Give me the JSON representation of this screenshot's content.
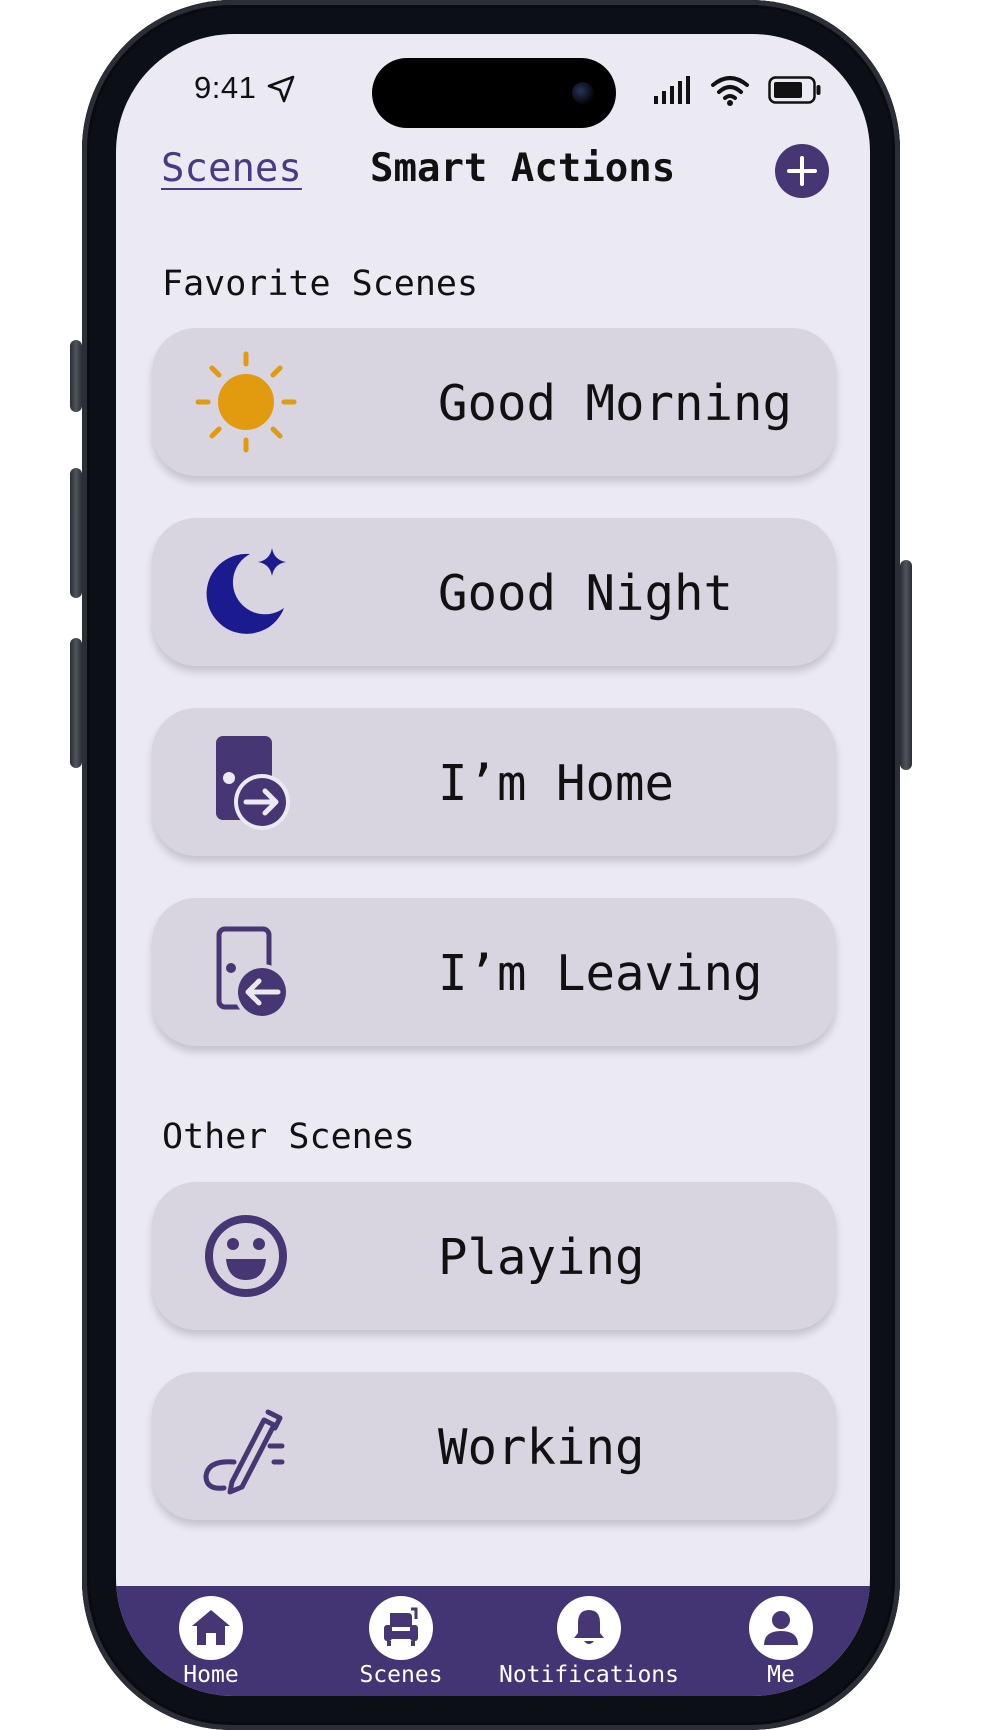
{
  "status_bar": {
    "time": "9:41"
  },
  "header": {
    "tab_scenes": "Scenes",
    "tab_smart_actions": "Smart Actions"
  },
  "favorites": {
    "title": "Favorite Scenes",
    "items": [
      {
        "label": "Good Morning",
        "icon": "sun-icon"
      },
      {
        "label": "Good Night",
        "icon": "moon-star-icon"
      },
      {
        "label": "I’m Home",
        "icon": "door-enter-icon"
      },
      {
        "label": "I’m Leaving",
        "icon": "door-leave-icon"
      }
    ]
  },
  "others": {
    "title": "Other Scenes",
    "items": [
      {
        "label": "Playing",
        "icon": "smiley-face-icon"
      },
      {
        "label": "Working",
        "icon": "pen-signature-icon"
      }
    ]
  },
  "bottom_nav": {
    "items": [
      {
        "label": "Home",
        "icon": "house-icon"
      },
      {
        "label": "Scenes",
        "icon": "armchair-icon"
      },
      {
        "label": "Notifications",
        "icon": "bell-icon"
      },
      {
        "label": "Me",
        "icon": "person-icon"
      }
    ]
  },
  "colors": {
    "accent": "#463774",
    "screen_bg": "#ebe9f2",
    "card_bg": "#d8d4e0",
    "sun": "#e29a0f",
    "moon": "#1c1a8f",
    "nav_bg": "#433574"
  }
}
